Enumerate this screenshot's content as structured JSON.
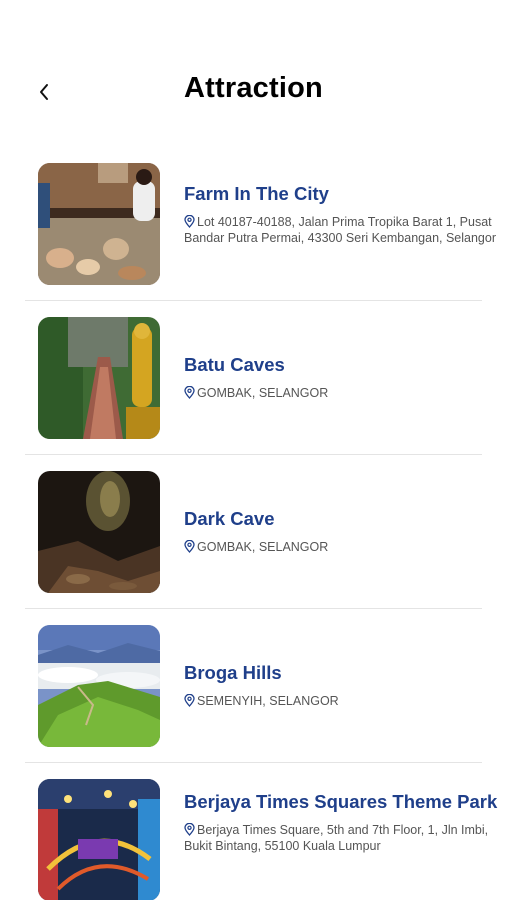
{
  "header": {
    "title": "Attraction",
    "back_icon": "chevron-left-icon"
  },
  "attractions": [
    {
      "name": "Farm In The City",
      "address": "Lot 40187-40188, Jalan Prima Tropika Barat 1, Pusat Bandar Putra Permai, 43300 Seri Kembangan, Selangor"
    },
    {
      "name": "Batu Caves",
      "address": "GOMBAK, SELANGOR"
    },
    {
      "name": "Dark Cave",
      "address": "GOMBAK, SELANGOR"
    },
    {
      "name": "Broga Hills",
      "address": "SEMENYIH, SELANGOR"
    },
    {
      "name": "Berjaya Times Squares Theme Park",
      "address": "Berjaya Times Square, 5th and 7th Floor, 1, Jln Imbi, Bukit Bintang, 55100 Kuala Lumpur"
    }
  ],
  "colors": {
    "title_text": "#000000",
    "attraction_name": "#1f3f8a",
    "address_text": "#555555"
  },
  "icons": {
    "location": "map-pin-icon"
  }
}
